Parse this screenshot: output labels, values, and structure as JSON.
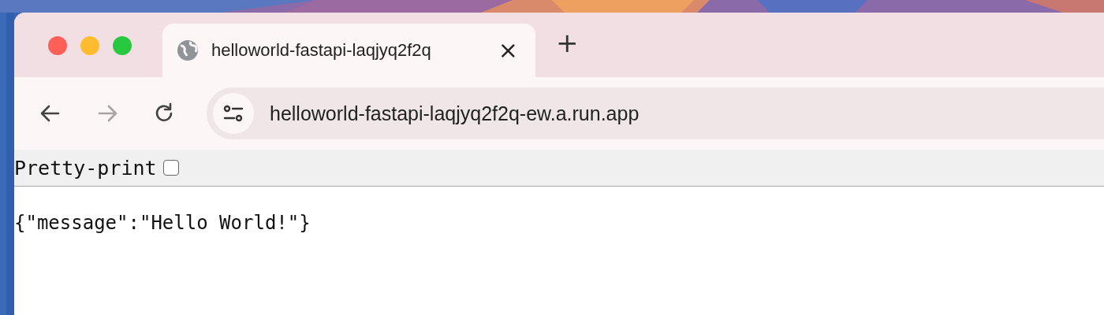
{
  "tabs": [
    {
      "title": "helloworld-fastapi-laqjyq2f2q",
      "close": "×",
      "selected": true
    }
  ],
  "new_tab": "+",
  "nav": [
    {
      "kind": "back",
      "disabled": false
    },
    {
      "kind": "forward",
      "disabled": true
    },
    {
      "kind": "reload",
      "disabled": false
    }
  ],
  "address_bar": {
    "url": "helloworld-fastapi-laqjyq2f2q-ew.a.run.app"
  },
  "pretty_print": {
    "label": "Pretty-print",
    "checked": false
  },
  "body": "{\"message\":\"Hello World!\"}"
}
